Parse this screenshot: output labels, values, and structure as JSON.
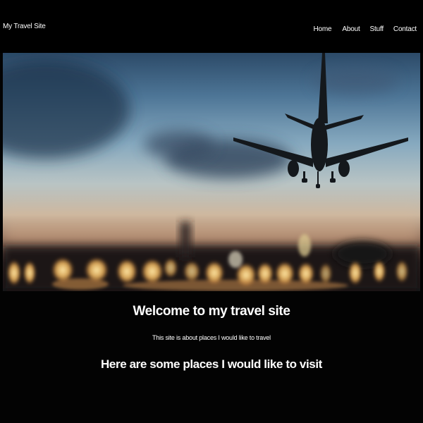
{
  "header": {
    "brand": "My Travel Site",
    "nav": [
      {
        "label": "Home"
      },
      {
        "label": "About"
      },
      {
        "label": "Stuff"
      },
      {
        "label": "Contact"
      }
    ]
  },
  "hero": {
    "image": "airplane-landing-at-dusk-photo"
  },
  "main": {
    "title": "Welcome to my travel site",
    "subtitle": "This site is about places I would like to travel",
    "section_heading": "Here are some places I would like to visit"
  }
}
